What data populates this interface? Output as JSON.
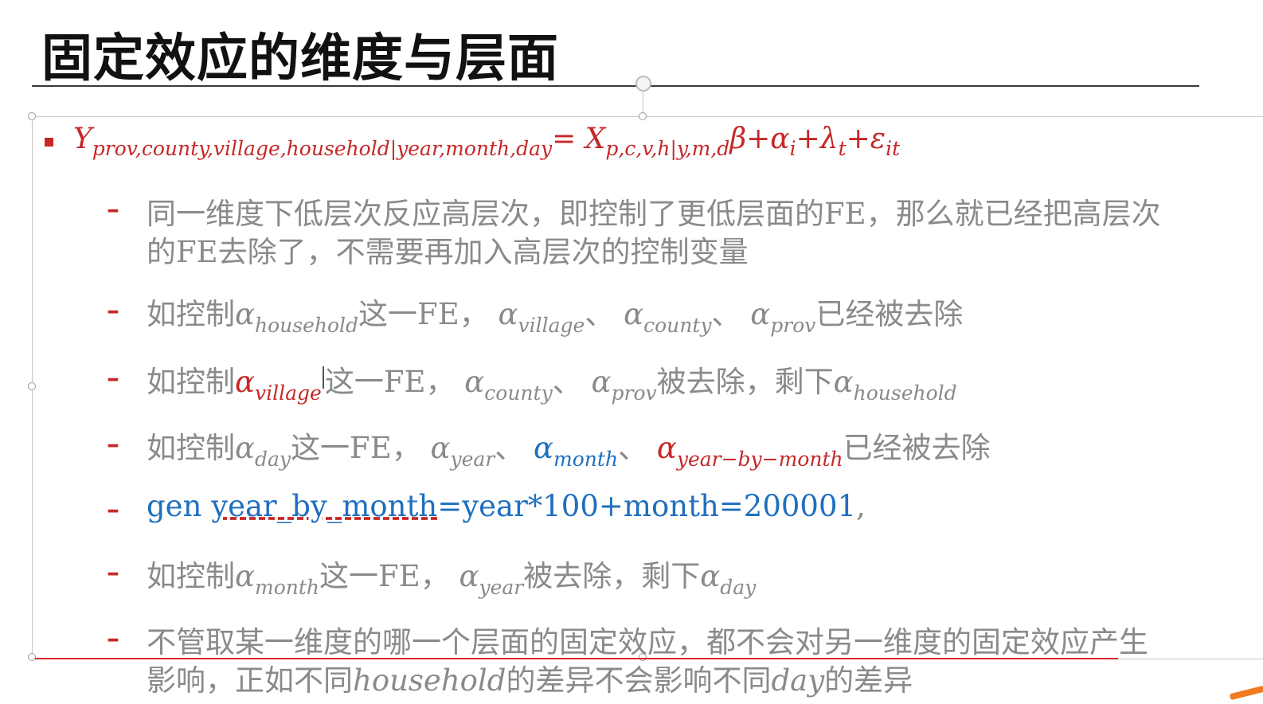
{
  "slide": {
    "title": "固定效应的维度与层面"
  },
  "formula": {
    "Y": "Y",
    "Y_sub": "prov,county,village,household|year,month,day",
    "eq": "=",
    "X": "X",
    "X_sub": "p,c,v,h|y,m,d",
    "rest": "β+α",
    "rest_sub_i": "i",
    "plus_lambda": "+λ",
    "lambda_sub": "t",
    "plus_eps": "+ε",
    "eps_sub": "it"
  },
  "items": [
    {
      "line1": "同一维度下低层次反应高层次，即控制了更低层面的FE，那么就已经把高层次",
      "line2": "的FE去除了，不需要再加入高层次的控制变量"
    },
    {
      "pre": "如控制",
      "a": "α",
      "s1": "household",
      "mid1": "这一FE，",
      "s2": "village",
      "sep1": "、",
      "s3": "county",
      "sep2": "、",
      "s4": "prov",
      "post": "已经被去除"
    },
    {
      "pre": "如控制",
      "a": "α",
      "s1": "village",
      "mid1": "这一FE，",
      "s2": "county",
      "sep1": "、",
      "s3": "prov",
      "mid2": "被去除，剩下",
      "s4": "household"
    },
    {
      "pre": "如控制",
      "a": "α",
      "s1": "day",
      "mid1": "这一FE，",
      "s2": "year",
      "sep1": "、",
      "s3": "month",
      "sep2": "、",
      "s4": "year−by−month",
      "post": "已经被去除"
    },
    {
      "code_a": "gen ",
      "code_b": "year_by_month",
      "code_c": "=year*100+month=200001",
      "code_d": ","
    },
    {
      "pre": "如控制",
      "a": "α",
      "s1": "month",
      "mid1": "这一FE，",
      "s2": "year",
      "mid2": "被去除，剩下",
      "s3": "day"
    },
    {
      "line1": "不管取某一维度的哪一个层面的固定效应，都不会对另一维度的固定效应产生",
      "line2_a": "影响，正如不同",
      "line2_b": "household",
      "line2_c": "的差异不会影响不同",
      "line2_d": "day",
      "line2_e": "的差异"
    }
  ],
  "colors": {
    "accent_red": "#c62828",
    "accent_blue": "#1f6fbf",
    "body_gray": "#8a8a8a",
    "handle_orange": "#f07b22"
  }
}
